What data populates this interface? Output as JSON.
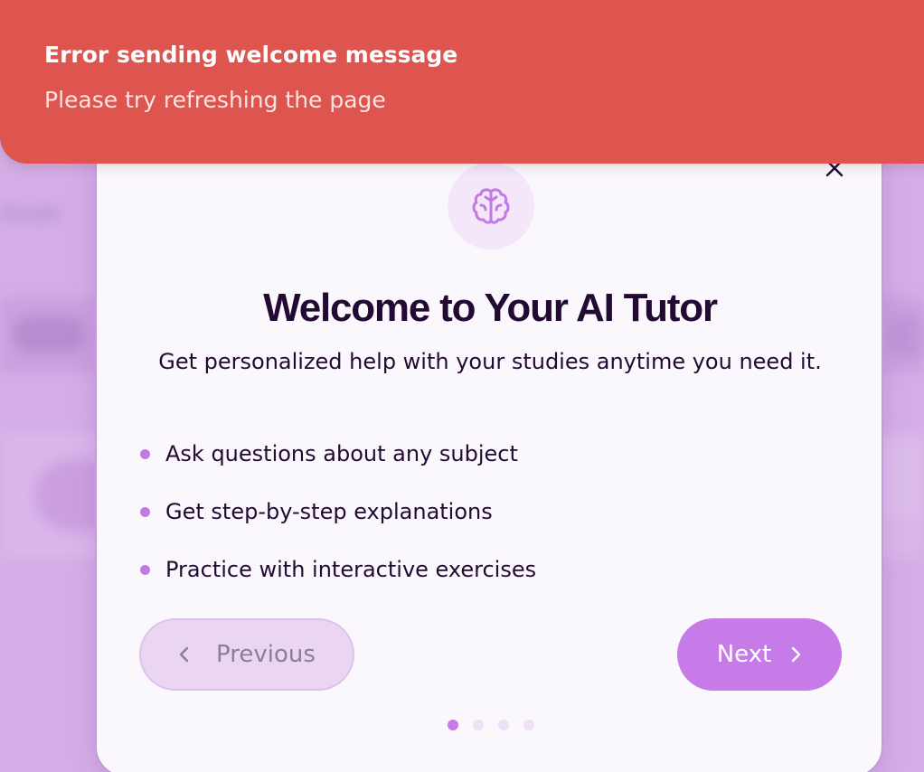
{
  "toast": {
    "title": "Error sending welcome message",
    "description": "Please try refreshing the page",
    "color": "#de544e"
  },
  "background": {
    "blurred_text": "Results"
  },
  "modal": {
    "icon": "brain-icon",
    "close_icon": "close-icon",
    "title": "Welcome to Your AI Tutor",
    "subtitle": "Get personalized help with your studies anytime you need it.",
    "features": [
      "Ask questions about any subject",
      "Get step-by-step explanations",
      "Practice with interactive exercises"
    ],
    "prev_label": "Previous",
    "next_label": "Next",
    "pager": {
      "total": 4,
      "current": 1
    },
    "accent_color": "#c67be8"
  }
}
